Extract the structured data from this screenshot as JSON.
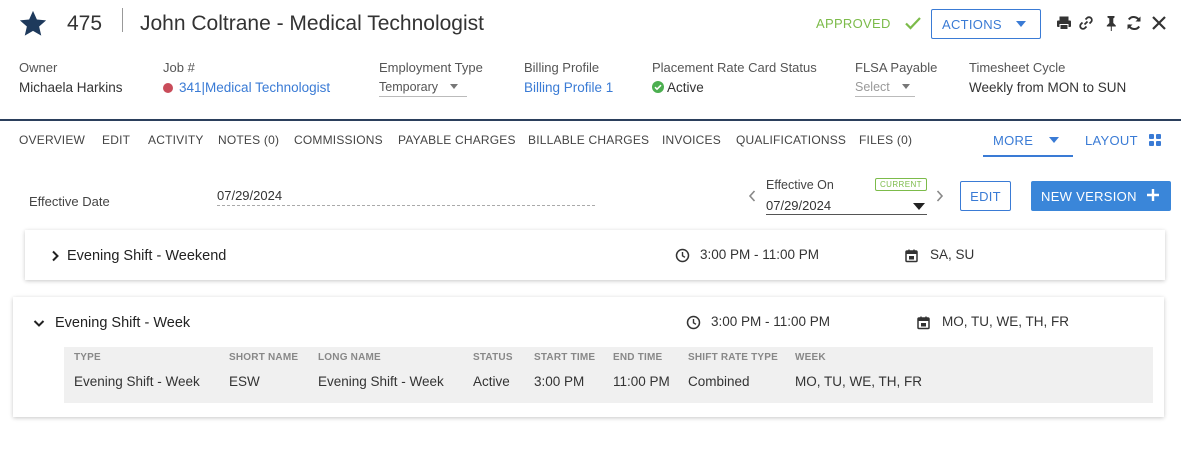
{
  "header": {
    "record_id": "475",
    "title": "John Coltrane - Medical Technologist",
    "status": "APPROVED",
    "actions_label": "ACTIONS"
  },
  "fields": {
    "owner": {
      "label": "Owner",
      "value": "Michaela Harkins"
    },
    "job": {
      "label": "Job #",
      "number": "341",
      "separator": "|",
      "name": "Medical Technologist"
    },
    "employment_type": {
      "label": "Employment Type",
      "value": "Temporary"
    },
    "billing_profile": {
      "label": "Billing Profile",
      "value": "Billing Profile 1"
    },
    "rate_card_status": {
      "label": "Placement Rate Card Status",
      "value": "Active"
    },
    "flsa_payable": {
      "label": "FLSA Payable",
      "placeholder": "Select"
    },
    "timesheet_cycle": {
      "label": "Timesheet Cycle",
      "value": "Weekly from MON to SUN"
    }
  },
  "tabs": [
    "OVERVIEW",
    "EDIT",
    "ACTIVITY",
    "NOTES (0)",
    "COMMISSIONS",
    "PAYABLE CHARGES",
    "BILLABLE CHARGES",
    "INVOICES",
    "QUALIFICATIONSS",
    "FILES (0)"
  ],
  "more_label": "MORE",
  "layout_label": "LAYOUT",
  "effective": {
    "date_label": "Effective Date",
    "date_value": "07/29/2024",
    "on_label": "Effective On",
    "current_badge": "CURRENT",
    "on_value": "07/29/2024",
    "edit_label": "EDIT",
    "new_version_label": "NEW VERSION"
  },
  "shifts": [
    {
      "name": "Evening Shift - Weekend",
      "time": "3:00 PM - 11:00 PM",
      "days": "SA, SU",
      "expanded": false
    },
    {
      "name": "Evening Shift - Week",
      "time": "3:00 PM - 11:00 PM",
      "days": "MO, TU, WE, TH, FR",
      "expanded": true
    }
  ],
  "detail": {
    "headers": [
      "TYPE",
      "SHORT NAME",
      "LONG NAME",
      "STATUS",
      "START TIME",
      "END TIME",
      "SHIFT RATE TYPE",
      "WEEK"
    ],
    "row": [
      "Evening Shift - Week",
      "ESW",
      "Evening Shift - Week",
      "Active",
      "3:00 PM",
      "11:00 PM",
      "Combined",
      "MO, TU, WE, TH, FR"
    ]
  },
  "colors": {
    "accent": "#3a7bd5",
    "approved": "#7cbb4a",
    "star": "#1e3a5c",
    "job_dot": "#c94c5a"
  },
  "icons": [
    "star-icon",
    "check-icon",
    "print-icon",
    "link-icon",
    "pin-icon",
    "refresh-icon",
    "close-icon",
    "layout-grid-icon",
    "clock-icon",
    "calendar-icon",
    "chevron-right-icon",
    "chevron-down-icon",
    "plus-icon"
  ]
}
